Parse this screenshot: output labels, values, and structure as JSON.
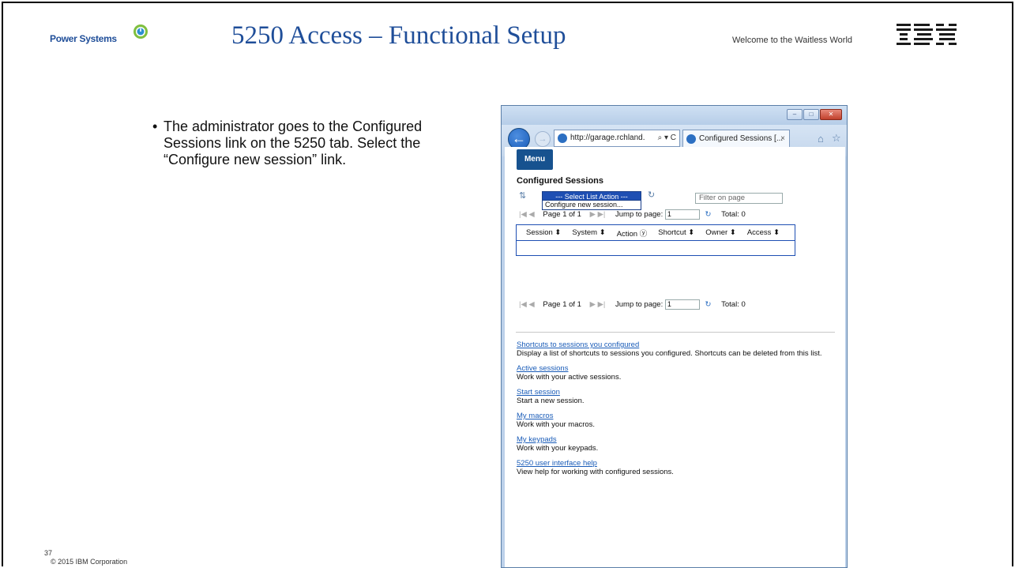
{
  "header": {
    "brand": "Power Systems",
    "title": "5250 Access – Functional Setup",
    "tagline": "Welcome to the Waitless World",
    "logo": "IBM"
  },
  "bullet": {
    "text": "The administrator goes to the Configured Sessions link on the 5250 tab.  Select the “Configure new session” link."
  },
  "footer": {
    "page_number": "37",
    "copyright": "© 2015 IBM Corporation"
  },
  "browser": {
    "address": "http://garage.rchland.",
    "address_tools": "⌕ ▾ C",
    "tab_label": "Configured Sessions [...",
    "tab_close": "×",
    "window_buttons": [
      "–",
      "□",
      "✕"
    ]
  },
  "app": {
    "menu_label": "Menu",
    "page_title": "Configured Sessions",
    "select_action": "--- Select List Action ---",
    "select_option": "Configure new session...",
    "filter_placeholder": "Filter on page",
    "pager": {
      "page_label": "Page 1 of 1",
      "jump_label": "Jump to page:",
      "jump_value": "1",
      "total_label": "Total: 0"
    },
    "columns": [
      "Session ⬍",
      "System ⬍",
      "Action ⓨ",
      "Shortcut ⬍",
      "Owner ⬍",
      "Access ⬍"
    ],
    "links": [
      {
        "link": "Shortcuts to sessions you configured",
        "desc": "Display a list of shortcuts to sessions you configured. Shortcuts can be deleted from this list."
      },
      {
        "link": "Active sessions",
        "desc": "Work with your active sessions."
      },
      {
        "link": "Start session",
        "desc": "Start a new session."
      },
      {
        "link": "My macros",
        "desc": "Work with your macros."
      },
      {
        "link": "My keypads",
        "desc": "Work with your keypads."
      },
      {
        "link": "5250 user interface help",
        "desc": "View help for working with configured sessions."
      }
    ]
  },
  "colors": {
    "title_blue": "#1f4e99",
    "link_blue": "#1a5cb8",
    "menu_blue": "#17528f"
  }
}
